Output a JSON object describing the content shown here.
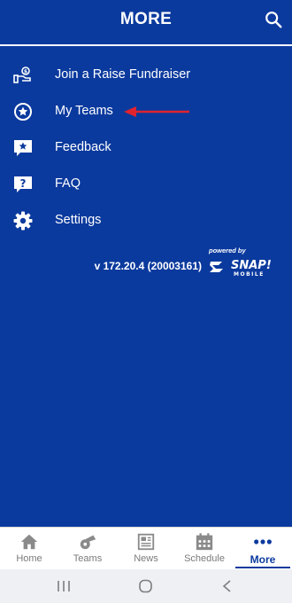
{
  "header": {
    "title": "MORE"
  },
  "menu": {
    "items": [
      {
        "label": "Join a Raise Fundraiser",
        "icon": "fundraiser-hand-icon"
      },
      {
        "label": "My Teams",
        "icon": "team-badge-icon"
      },
      {
        "label": "Feedback",
        "icon": "feedback-star-icon"
      },
      {
        "label": "FAQ",
        "icon": "faq-question-icon"
      },
      {
        "label": "Settings",
        "icon": "settings-gear-icon"
      }
    ]
  },
  "footer_info": {
    "version": "v 172.20.4 (20003161)",
    "powered_by": "powered by",
    "brand": "SNAP!",
    "brand_sub": "MOBILE"
  },
  "tabs": [
    {
      "label": "Home",
      "icon": "home-icon"
    },
    {
      "label": "Teams",
      "icon": "whistle-icon"
    },
    {
      "label": "News",
      "icon": "newspaper-icon"
    },
    {
      "label": "Schedule",
      "icon": "calendar-icon"
    },
    {
      "label": "More",
      "icon": "more-dots-icon",
      "active": true
    }
  ],
  "colors": {
    "primary": "#0b3a9e",
    "arrow": "#e0232e",
    "tab_inactive": "#7a7a7a"
  }
}
